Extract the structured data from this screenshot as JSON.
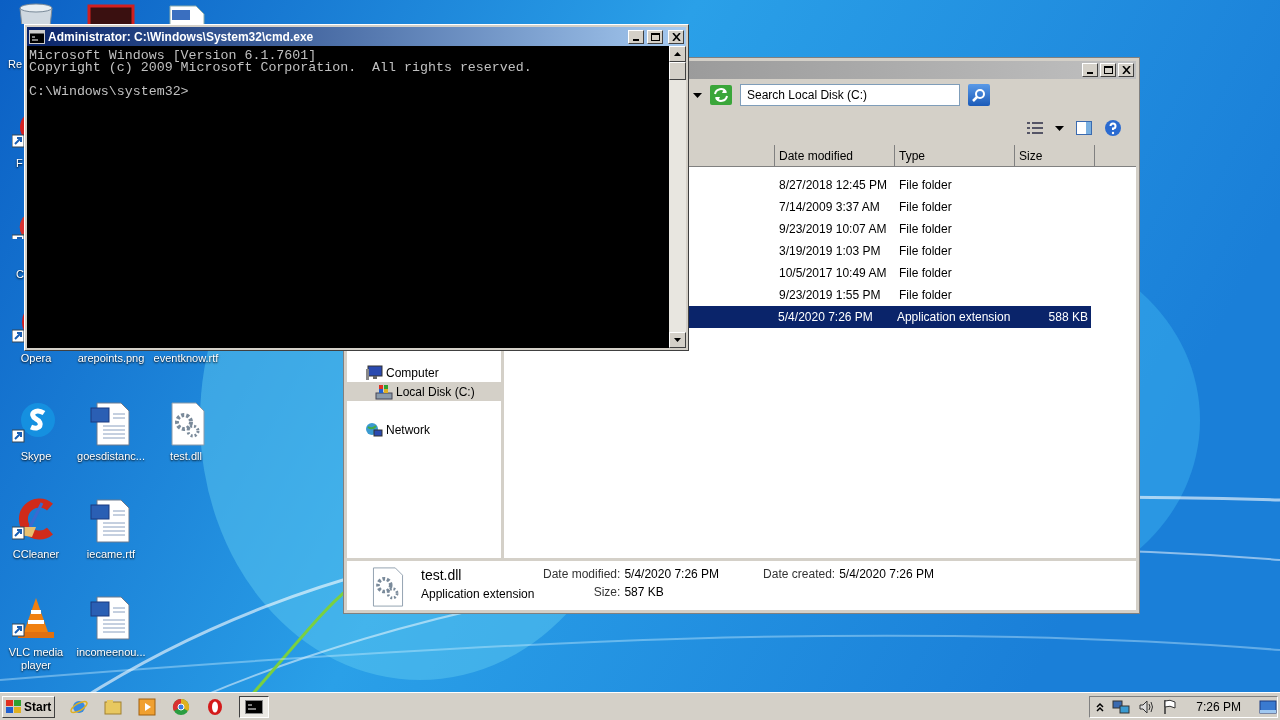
{
  "desktop": {
    "icons": [
      {
        "kind": "recycle"
      },
      {
        "kind": "redbox"
      },
      {
        "kind": "page"
      },
      {
        "kind": "red_app",
        "shortcut": true
      },
      {
        "kind": "chrome",
        "shortcut": true
      },
      {
        "kind": "opera",
        "shortcut": true,
        "label": "Opera"
      },
      {
        "label": "arepoints.png"
      },
      {
        "label": "eventknow.rtf"
      },
      {
        "kind": "skype",
        "shortcut": true,
        "label": "Skype"
      },
      {
        "kind": "word",
        "label": "goesdistanc..."
      },
      {
        "kind": "dll",
        "label": "test.dll"
      },
      {
        "kind": "ccleaner",
        "shortcut": true,
        "label": "CCleaner"
      },
      {
        "kind": "word",
        "label": "iecame.rtf"
      },
      {
        "kind": "vlc",
        "shortcut": true,
        "label": "VLC media player"
      },
      {
        "kind": "word",
        "label": "incomeenou..."
      }
    ],
    "cut_labels": [
      "Re",
      "F",
      "C"
    ]
  },
  "cmd_window": {
    "title": "Administrator: C:\\Windows\\System32\\cmd.exe",
    "output": [
      "Microsoft Windows [Version 6.1.7601]",
      "Copyright (c) 2009 Microsoft Corporation.  All rights reserved."
    ],
    "prompt": "C:\\Windows\\system32>"
  },
  "explorer": {
    "search": {
      "placeholder": "Search Local Disk (C:)"
    },
    "columns": [
      "Date modified",
      "Type",
      "Size"
    ],
    "rows": [
      {
        "date": "8/27/2018 12:45 PM",
        "type": "File folder",
        "selected": false
      },
      {
        "date": "7/14/2009 3:37 AM",
        "type": "File folder",
        "selected": false
      },
      {
        "date": "9/23/2019 10:07 AM",
        "type": "File folder",
        "selected": false
      },
      {
        "date": "3/19/2019 1:03 PM",
        "type": "File folder",
        "selected": false
      },
      {
        "date": "10/5/2017 10:49 AM",
        "type": "File folder",
        "selected": false
      },
      {
        "date": "9/23/2019 1:55 PM",
        "type": "File folder",
        "selected": false
      },
      {
        "date": "5/4/2020 7:26 PM",
        "type": "Application extension",
        "size": "588 KB",
        "selected": true
      }
    ],
    "nav": [
      {
        "label": "Computer",
        "kind": "computer",
        "selected": false,
        "children": [
          {
            "label": "Local Disk (C:)",
            "kind": "drive",
            "selected": true
          }
        ]
      },
      {
        "label": "Network",
        "kind": "network",
        "selected": false
      }
    ],
    "details": {
      "name": "test.dll",
      "type": "Application extension",
      "groups": [
        [
          {
            "label": "Date modified:",
            "value": "5/4/2020 7:26 PM"
          },
          {
            "label": "Size:",
            "value": "587 KB"
          }
        ],
        [
          {
            "label": "Date created:",
            "value": "5/4/2020 7:26 PM"
          }
        ]
      ]
    }
  },
  "taskbar": {
    "start": "Start",
    "apps": [
      {
        "kind": "ie",
        "active": false
      },
      {
        "kind": "folder",
        "active": false
      },
      {
        "kind": "media",
        "active": false
      },
      {
        "kind": "chrome",
        "active": false
      },
      {
        "kind": "opera",
        "active": false
      },
      {
        "kind": "cmd",
        "active": true
      }
    ],
    "clock": "7:26 PM"
  }
}
